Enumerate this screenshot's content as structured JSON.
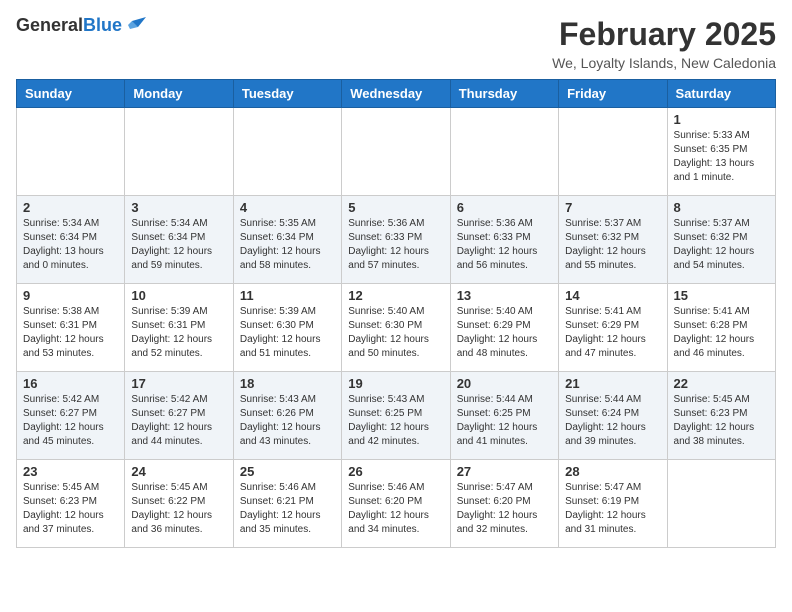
{
  "header": {
    "logo_line1": "General",
    "logo_line2": "Blue",
    "month": "February 2025",
    "location": "We, Loyalty Islands, New Caledonia"
  },
  "weekdays": [
    "Sunday",
    "Monday",
    "Tuesday",
    "Wednesday",
    "Thursday",
    "Friday",
    "Saturday"
  ],
  "weeks": [
    [
      {
        "day": "",
        "info": ""
      },
      {
        "day": "",
        "info": ""
      },
      {
        "day": "",
        "info": ""
      },
      {
        "day": "",
        "info": ""
      },
      {
        "day": "",
        "info": ""
      },
      {
        "day": "",
        "info": ""
      },
      {
        "day": "1",
        "info": "Sunrise: 5:33 AM\nSunset: 6:35 PM\nDaylight: 13 hours\nand 1 minute."
      }
    ],
    [
      {
        "day": "2",
        "info": "Sunrise: 5:34 AM\nSunset: 6:34 PM\nDaylight: 13 hours\nand 0 minutes."
      },
      {
        "day": "3",
        "info": "Sunrise: 5:34 AM\nSunset: 6:34 PM\nDaylight: 12 hours\nand 59 minutes."
      },
      {
        "day": "4",
        "info": "Sunrise: 5:35 AM\nSunset: 6:34 PM\nDaylight: 12 hours\nand 58 minutes."
      },
      {
        "day": "5",
        "info": "Sunrise: 5:36 AM\nSunset: 6:33 PM\nDaylight: 12 hours\nand 57 minutes."
      },
      {
        "day": "6",
        "info": "Sunrise: 5:36 AM\nSunset: 6:33 PM\nDaylight: 12 hours\nand 56 minutes."
      },
      {
        "day": "7",
        "info": "Sunrise: 5:37 AM\nSunset: 6:32 PM\nDaylight: 12 hours\nand 55 minutes."
      },
      {
        "day": "8",
        "info": "Sunrise: 5:37 AM\nSunset: 6:32 PM\nDaylight: 12 hours\nand 54 minutes."
      }
    ],
    [
      {
        "day": "9",
        "info": "Sunrise: 5:38 AM\nSunset: 6:31 PM\nDaylight: 12 hours\nand 53 minutes."
      },
      {
        "day": "10",
        "info": "Sunrise: 5:39 AM\nSunset: 6:31 PM\nDaylight: 12 hours\nand 52 minutes."
      },
      {
        "day": "11",
        "info": "Sunrise: 5:39 AM\nSunset: 6:30 PM\nDaylight: 12 hours\nand 51 minutes."
      },
      {
        "day": "12",
        "info": "Sunrise: 5:40 AM\nSunset: 6:30 PM\nDaylight: 12 hours\nand 50 minutes."
      },
      {
        "day": "13",
        "info": "Sunrise: 5:40 AM\nSunset: 6:29 PM\nDaylight: 12 hours\nand 48 minutes."
      },
      {
        "day": "14",
        "info": "Sunrise: 5:41 AM\nSunset: 6:29 PM\nDaylight: 12 hours\nand 47 minutes."
      },
      {
        "day": "15",
        "info": "Sunrise: 5:41 AM\nSunset: 6:28 PM\nDaylight: 12 hours\nand 46 minutes."
      }
    ],
    [
      {
        "day": "16",
        "info": "Sunrise: 5:42 AM\nSunset: 6:27 PM\nDaylight: 12 hours\nand 45 minutes."
      },
      {
        "day": "17",
        "info": "Sunrise: 5:42 AM\nSunset: 6:27 PM\nDaylight: 12 hours\nand 44 minutes."
      },
      {
        "day": "18",
        "info": "Sunrise: 5:43 AM\nSunset: 6:26 PM\nDaylight: 12 hours\nand 43 minutes."
      },
      {
        "day": "19",
        "info": "Sunrise: 5:43 AM\nSunset: 6:25 PM\nDaylight: 12 hours\nand 42 minutes."
      },
      {
        "day": "20",
        "info": "Sunrise: 5:44 AM\nSunset: 6:25 PM\nDaylight: 12 hours\nand 41 minutes."
      },
      {
        "day": "21",
        "info": "Sunrise: 5:44 AM\nSunset: 6:24 PM\nDaylight: 12 hours\nand 39 minutes."
      },
      {
        "day": "22",
        "info": "Sunrise: 5:45 AM\nSunset: 6:23 PM\nDaylight: 12 hours\nand 38 minutes."
      }
    ],
    [
      {
        "day": "23",
        "info": "Sunrise: 5:45 AM\nSunset: 6:23 PM\nDaylight: 12 hours\nand 37 minutes."
      },
      {
        "day": "24",
        "info": "Sunrise: 5:45 AM\nSunset: 6:22 PM\nDaylight: 12 hours\nand 36 minutes."
      },
      {
        "day": "25",
        "info": "Sunrise: 5:46 AM\nSunset: 6:21 PM\nDaylight: 12 hours\nand 35 minutes."
      },
      {
        "day": "26",
        "info": "Sunrise: 5:46 AM\nSunset: 6:20 PM\nDaylight: 12 hours\nand 34 minutes."
      },
      {
        "day": "27",
        "info": "Sunrise: 5:47 AM\nSunset: 6:20 PM\nDaylight: 12 hours\nand 32 minutes."
      },
      {
        "day": "28",
        "info": "Sunrise: 5:47 AM\nSunset: 6:19 PM\nDaylight: 12 hours\nand 31 minutes."
      },
      {
        "day": "",
        "info": ""
      }
    ]
  ]
}
